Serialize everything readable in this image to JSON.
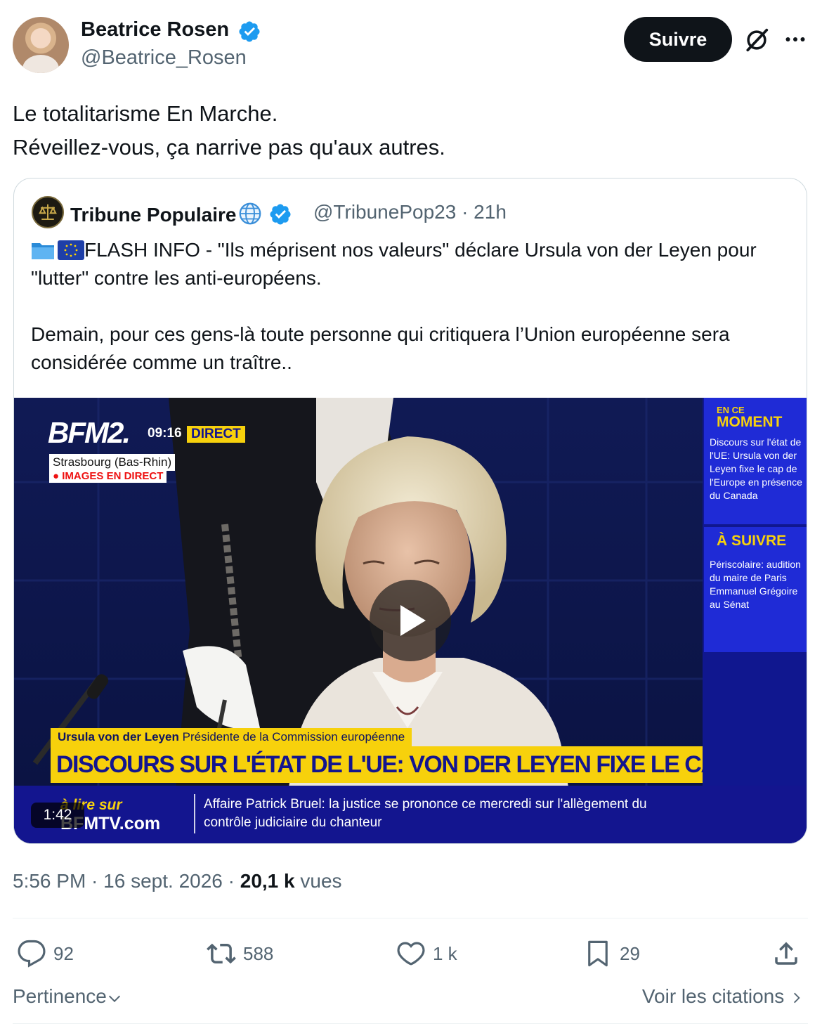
{
  "author": {
    "name": "Beatrice Rosen",
    "handle": "@Beatrice_Rosen",
    "follow_label": "Suivre"
  },
  "post": {
    "line1": "Le totalitarisme En Marche.",
    "line2": "Réveillez-vous, ça narrive pas qu'aux autres."
  },
  "quote": {
    "name": "Tribune Populaire",
    "handle": "@TribunePop23 · 21h",
    "text_line1": "FLASH INFO - \"Ils méprisent nos valeurs\" déclare Ursula von der Leyen pour \"lutter\" contre les anti-européens.",
    "text_line2": "Demain, pour ces gens-là toute personne qui critiquera l’Union européenne sera considérée comme un traître..",
    "video": {
      "duration": "1:42",
      "channel_logo": "BFM2.",
      "time": "09:16",
      "direct": "DIRECT",
      "location": "Strasbourg (Bas-Rhin)",
      "live_tag": "● IMAGES EN DIRECT",
      "side_head_small": "EN CE",
      "side_head_big": "MOMENT",
      "side_text1": "Discours sur l'état de l'UE: Ursula von der Leyen fixe le cap de l'Europe en présence du Canada",
      "side_head2": "À SUIVRE",
      "side_text2": "Périscolaire: audition du maire de Paris Emmanuel Grégoire au Sénat",
      "lower_name": "Ursula von der Leyen",
      "lower_role": "Présidente de la Commission européenne",
      "headline": "DISCOURS SUR L'ÉTAT DE L'UE: VON DER LEYEN FIXE LE CAP",
      "ticker_brand_top": "à lire sur",
      "ticker_brand_bottom": "BFMTV.com",
      "ticker_text": "Affaire Patrick Bruel: la justice se prononce ce mercredi sur l'allègement du contrôle judiciaire du chanteur"
    }
  },
  "meta": {
    "time_date": "5:56 PM · 16 sept. 2026 · ",
    "views_count": "20,1 k",
    "views_label": " vues"
  },
  "actions": {
    "replies": "92",
    "reposts": "588",
    "likes": "1 k",
    "bookmarks": "29"
  },
  "bottom": {
    "sort_label": "Pertinence",
    "quotes_label": "Voir les citations"
  },
  "colors": {
    "verified": "#1d9bf0",
    "bfm_yellow": "#f7d10c",
    "bfm_blue": "#1f2bd6"
  },
  "icons": [
    "verified-badge-icon",
    "grok-icon",
    "more-icon",
    "folder-icon",
    "eu-flag-icon",
    "globe-icon",
    "play-icon",
    "reply-icon",
    "repost-icon",
    "like-icon",
    "bookmark-icon",
    "share-icon",
    "chevron-down-icon",
    "chevron-right-icon"
  ]
}
